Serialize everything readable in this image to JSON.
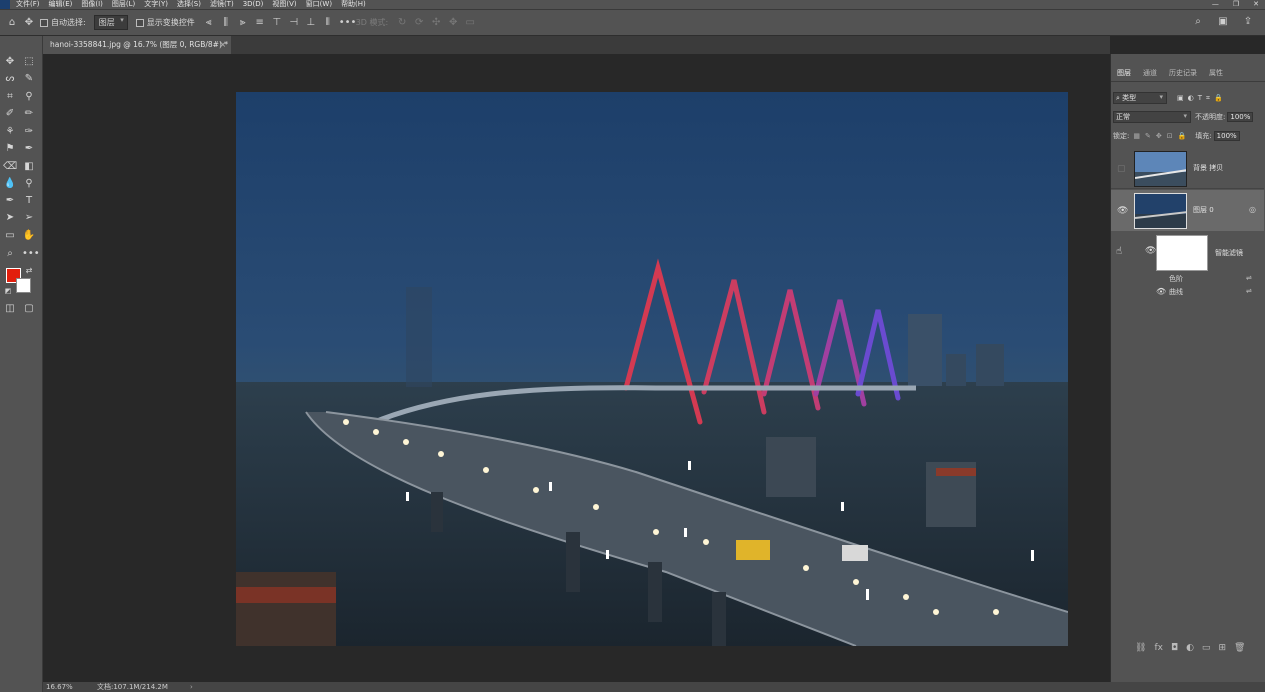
{
  "menubar": {
    "items": [
      "文件(F)",
      "编辑(E)",
      "图像(I)",
      "图层(L)",
      "文字(Y)",
      "选择(S)",
      "滤镜(T)",
      "3D(D)",
      "视图(V)",
      "窗口(W)",
      "帮助(H)"
    ],
    "window_controls": [
      "—",
      "❐",
      "✕"
    ]
  },
  "options_bar": {
    "auto_select_label": "自动选择:",
    "auto_select_target": "图层",
    "show_transform_label": "显示变换控件",
    "mode_3d_label": "3D 模式:"
  },
  "document": {
    "tab_title": "hanoi-3358841.jpg @ 16.7% (图层 0, RGB/8#) *",
    "close": "×"
  },
  "status": {
    "zoom": "16.67%",
    "doc_size": "文档:107.1M/214.2M",
    "arrow": "›"
  },
  "panel": {
    "tabs": [
      "图层",
      "通道",
      "历史记录",
      "属性"
    ],
    "active_tab": "图层",
    "filter_kind": "类型",
    "blend_mode": "正常",
    "opacity_label": "不透明度:",
    "opacity_value": "100%",
    "lock_label": "锁定:",
    "fill_label": "填充:",
    "fill_value": "100%",
    "layers": [
      {
        "name": "背景 拷贝",
        "visible": false
      },
      {
        "name": "图层 0",
        "visible": true,
        "selected": true
      }
    ],
    "smart_filters_label": "智能滤镜",
    "filters": [
      "色阶",
      "曲线"
    ]
  },
  "colors": {
    "foreground": "#e21f0d",
    "background": "#ffffff",
    "ui_panel": "#535353",
    "canvas_bg": "#282828"
  }
}
